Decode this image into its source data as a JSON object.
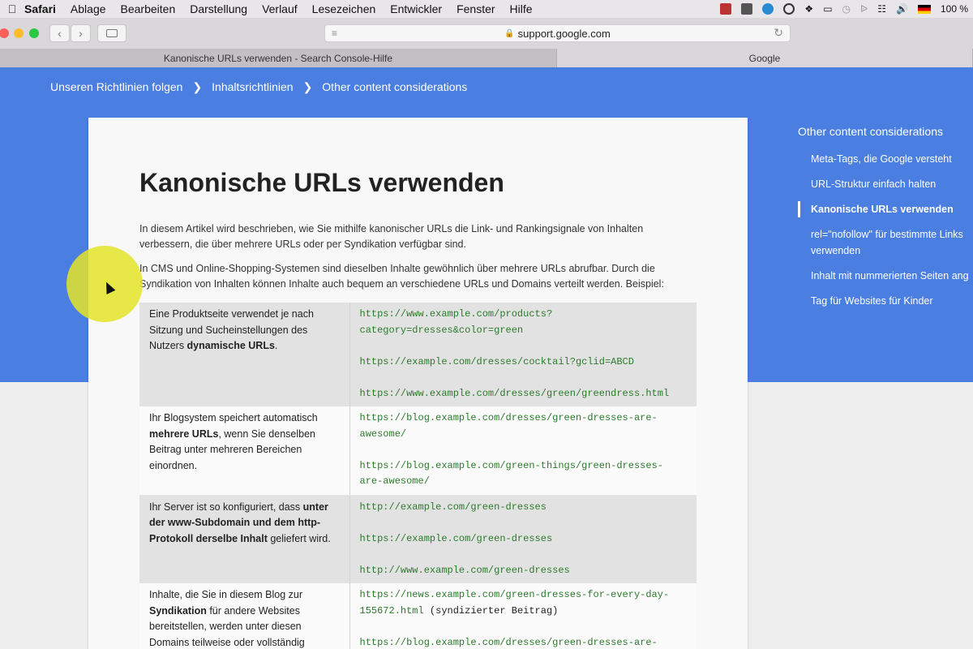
{
  "menubar": {
    "app": "Safari",
    "items": [
      "Ablage",
      "Bearbeiten",
      "Darstellung",
      "Verlauf",
      "Lesezeichen",
      "Entwickler",
      "Fenster",
      "Hilfe"
    ],
    "battery": "100 %"
  },
  "browser": {
    "address": "support.google.com",
    "tabs": [
      {
        "title": "Kanonische URLs verwenden - Search Console-Hilfe",
        "active": false
      },
      {
        "title": "Google",
        "active": true
      }
    ]
  },
  "breadcrumb": [
    "Unseren Richtlinien folgen",
    "Inhaltsrichtlinien",
    "Other content considerations"
  ],
  "article": {
    "title": "Kanonische URLs verwenden",
    "intro": "In diesem Artikel wird beschrieben, wie Sie mithilfe kanonischer URLs die Link- und Rankingsignale von Inhalten verbessern, die über mehrere URLs oder per Syndikation verfügbar sind.",
    "para2": "In CMS und Online-Shopping-Systemen sind dieselben Inhalte gewöhnlich über mehrere URLs abrufbar. Durch die Syndikation von Inhalten können Inhalte auch bequem an verschiedene URLs und Domains verteilt werden. Beispiel:",
    "rows": [
      {
        "desc_a": "Eine Produktseite verwendet je nach Sitzung und Sucheinstellungen des Nutzers ",
        "desc_b": "dynamische URLs",
        "desc_c": ".",
        "urls": [
          "https://www.example.com/products?\ncategory=dresses&color=green",
          "https://example.com/dresses/cocktail?gclid=ABCD",
          "https://www.example.com/dresses/green/greendress.html"
        ]
      },
      {
        "desc_a": "Ihr Blogsystem speichert automatisch ",
        "desc_b": "mehrere URLs",
        "desc_c": ", wenn Sie denselben Beitrag unter mehreren Bereichen einordnen.",
        "urls": [
          "https://blog.example.com/dresses/green-dresses-are-\nawesome/",
          "https://blog.example.com/green-things/green-dresses-\nare-awesome/"
        ]
      },
      {
        "desc_a": "Ihr Server ist so konfiguriert, dass ",
        "desc_b": "unter der www-Subdomain und dem http-Protokoll derselbe Inhalt",
        "desc_c": " geliefert wird.",
        "urls": [
          "http://example.com/green-dresses",
          "https://example.com/green-dresses",
          "http://www.example.com/green-dresses"
        ]
      },
      {
        "desc_a": "Inhalte, die Sie in diesem Blog zur ",
        "desc_b": "Syndikation",
        "desc_c": " für andere Websites bereitstellen, werden unter diesen Domains teilweise oder vollständig",
        "url1": "https://news.example.com/green-dresses-for-every-day-\n155672.html",
        "url1_note": " (syndizierter Beitrag)",
        "url2": "https://blog.example.com/dresses/green-dresses-are-"
      }
    ]
  },
  "toc": {
    "title": "Other content considerations",
    "items": [
      {
        "label": "Meta-Tags, die Google versteht",
        "active": false
      },
      {
        "label": "URL-Struktur einfach halten",
        "active": false
      },
      {
        "label": "Kanonische URLs verwenden",
        "active": true
      },
      {
        "label": "rel=\"nofollow\" für bestimmte Links",
        "active": false
      },
      {
        "label": "verwenden",
        "active": false
      },
      {
        "label": "Inhalt mit nummerierten Seiten ang",
        "active": false
      },
      {
        "label": "Tag für Websites für Kinder",
        "active": false
      }
    ]
  },
  "colors": {
    "header_blue": "#4a7ee0",
    "url_green": "#2c7a2c",
    "cursor_highlight": "#e4e428"
  },
  "icons": [
    "apple-icon",
    "back-icon",
    "forward-icon",
    "sidebar-icon",
    "reader-icon",
    "lock-icon",
    "reload-icon",
    "wifi-icon",
    "volume-icon",
    "bluetooth-icon",
    "dropbox-icon",
    "airplay-icon",
    "time-machine-icon",
    "german-flag-icon",
    "mouse-pointer-icon"
  ]
}
